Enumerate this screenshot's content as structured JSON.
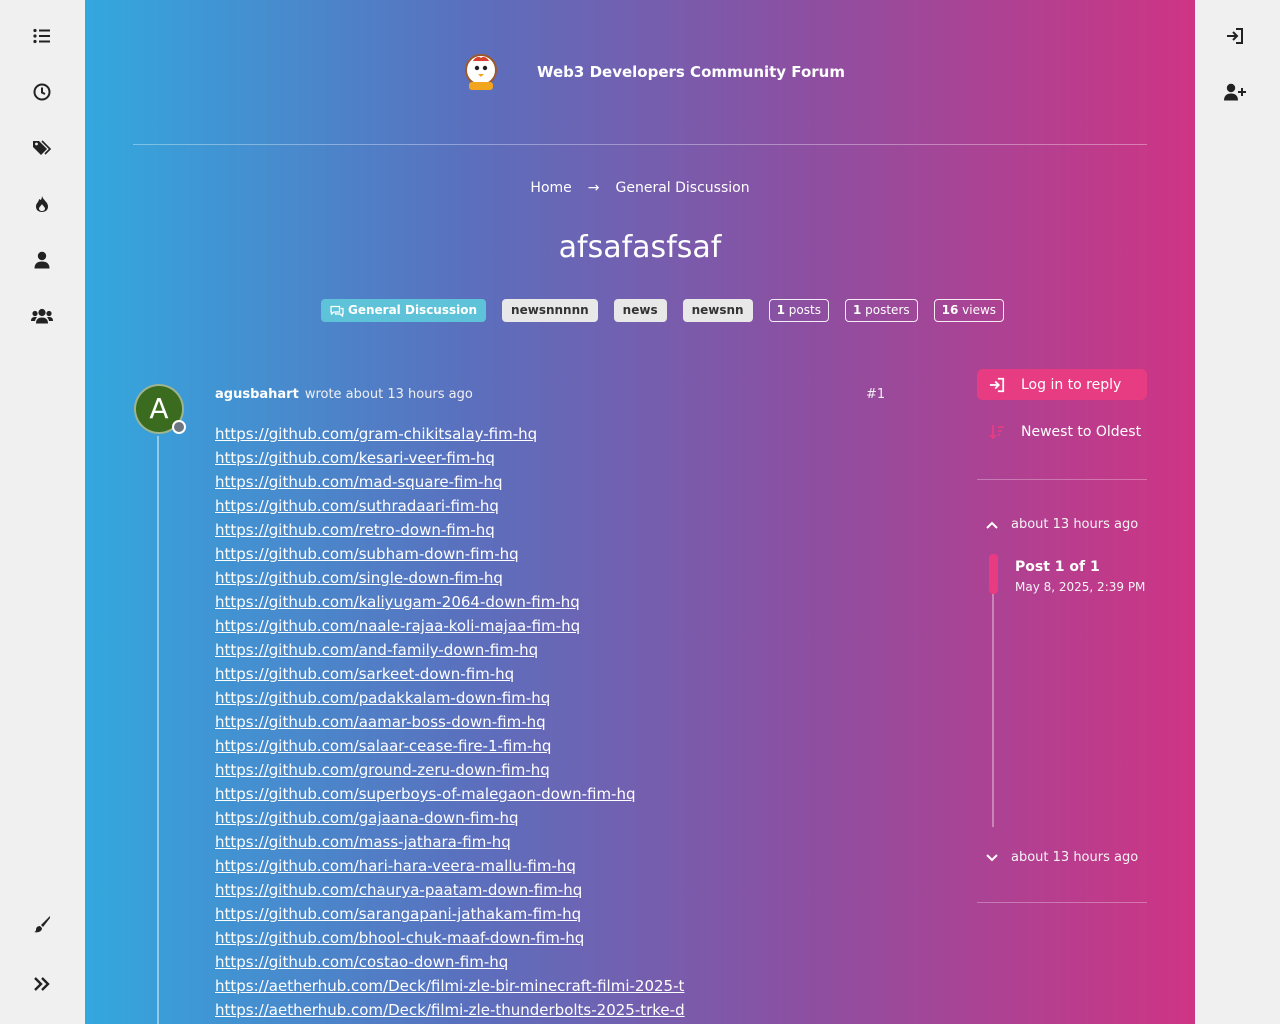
{
  "brand": {
    "title": "Web3 Developers Community Forum"
  },
  "left_nav": [
    {
      "icon": "list-icon"
    },
    {
      "icon": "clock-icon"
    },
    {
      "icon": "tags-icon"
    },
    {
      "icon": "fire-icon"
    },
    {
      "icon": "user-icon"
    },
    {
      "icon": "users-icon"
    }
  ],
  "breadcrumb": {
    "home": "Home",
    "separator": "→",
    "category": "General Discussion"
  },
  "topic": {
    "title": "afsafasfsaf",
    "category": "General Discussion",
    "tags": [
      "newsnnnnn",
      "news",
      "newsnn"
    ],
    "stats": {
      "posts_count": "1",
      "posts_label": "posts",
      "posters_count": "1",
      "posters_label": "posters",
      "views_count": "16",
      "views_label": "views"
    }
  },
  "post": {
    "avatar_letter": "A",
    "author": "agusbahart",
    "wrote": "wrote about 13 hours ago",
    "index": "#1",
    "links": [
      "https://github.com/gram-chikitsalay-fim-hq",
      "https://github.com/kesari-veer-fim-hq",
      "https://github.com/mad-square-fim-hq",
      "https://github.com/suthradaari-fim-hq",
      "https://github.com/retro-down-fim-hq",
      "https://github.com/subham-down-fim-hq",
      "https://github.com/single-down-fim-hq",
      "https://github.com/kaliyugam-2064-down-fim-hq",
      "https://github.com/naale-rajaa-koli-majaa-fim-hq",
      "https://github.com/and-family-down-fim-hq",
      "https://github.com/sarkeet-down-fim-hq",
      "https://github.com/padakkalam-down-fim-hq",
      "https://github.com/aamar-boss-down-fim-hq",
      "https://github.com/salaar-cease-fire-1-fim-hq",
      "https://github.com/ground-zeru-down-fim-hq",
      "https://github.com/superboys-of-malegaon-down-fim-hq",
      "https://github.com/gajaana-down-fim-hq",
      "https://github.com/mass-jathara-fim-hq",
      "https://github.com/hari-hara-veera-mallu-fim-hq",
      "https://github.com/chaurya-paatam-down-fim-hq",
      "https://github.com/sarangapani-jathakam-fim-hq",
      "https://github.com/bhool-chuk-maaf-down-fim-hq",
      "https://github.com/costao-down-fim-hq",
      "https://aetherhub.com/Deck/filmi-zle-bir-minecraft-filmi-2025-t",
      "https://aetherhub.com/Deck/filmi-zle-thunderbolts-2025-trke-d"
    ]
  },
  "actions": {
    "reply": "Log in to reply",
    "sort": "Newest to Oldest"
  },
  "timeline": {
    "top": "about 13 hours ago",
    "title": "Post 1 of 1",
    "date": "May 8, 2025, 2:39 PM",
    "bottom": "about 13 hours ago"
  },
  "colors": {
    "accent": "#e73b82",
    "category": "#5ec3d8",
    "avatar": "#3a6b1f"
  }
}
